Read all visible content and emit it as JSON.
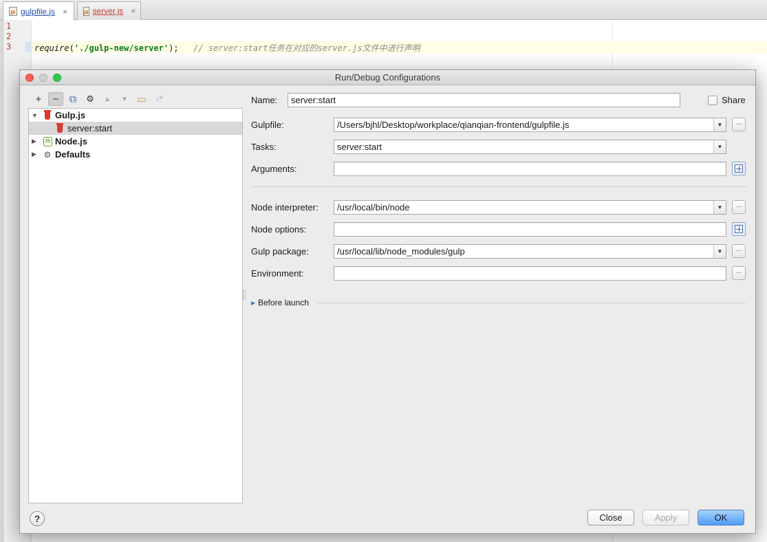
{
  "editor": {
    "tabs": [
      {
        "label": "gulpfile.js",
        "active": true
      },
      {
        "label": "server.js",
        "active": false
      }
    ],
    "tab_close": "×",
    "file_icon": "JS",
    "line_numbers": [
      "1",
      "2",
      "3"
    ],
    "code_line3": {
      "fn": "require",
      "open": "(",
      "str": "'./gulp-new/server'",
      "close": ");",
      "comment": "// server:start任务在对应的server.js文件中进行声明"
    }
  },
  "dialog": {
    "title": "Run/Debug Configurations",
    "toolbar": {
      "add": "+",
      "remove": "−",
      "copy": "⧉",
      "edit_defaults": "⚙",
      "move_up": "▲",
      "move_down": "▼",
      "folder": "▭",
      "sort": "↓ª"
    },
    "tree": [
      {
        "label": "Gulp.js",
        "expanded": true,
        "icon": "gulp-icon"
      },
      {
        "label": "server:start",
        "selected": true,
        "icon": "gulp-icon"
      },
      {
        "label": "Node.js",
        "expanded": false,
        "icon": "nodejs-icon"
      },
      {
        "label": "Defaults",
        "expanded": false,
        "icon": "wrench-icon"
      }
    ],
    "tree_arrows": {
      "expanded": "▼",
      "collapsed": "▶"
    },
    "node_icon_text": "JS",
    "wrench": "🔧",
    "form": {
      "name_label": "Name:",
      "name_value": "server:start",
      "share_label": "Share",
      "gulpfile_label": "Gulpfile:",
      "gulpfile_value": "/Users/bjhl/Desktop/workplace/qianqian-frontend/gulpfile.js",
      "tasks_label": "Tasks:",
      "tasks_value": "server:start",
      "arguments_label": "Arguments:",
      "arguments_value": "",
      "node_interpreter_label": "Node interpreter:",
      "node_interpreter_value": "/usr/local/bin/node",
      "node_options_label": "Node options:",
      "node_options_value": "",
      "gulp_package_label": "Gulp package:",
      "gulp_package_value": "/usr/local/lib/node_modules/gulp",
      "environment_label": "Environment:",
      "environment_value": "",
      "before_launch_label": "Before launch",
      "dropdown_arrow": "▼",
      "browse": "...",
      "before_launch_arrow": "▶"
    },
    "buttons": {
      "help": "?",
      "close": "Close",
      "apply": "Apply",
      "ok": "OK"
    }
  }
}
